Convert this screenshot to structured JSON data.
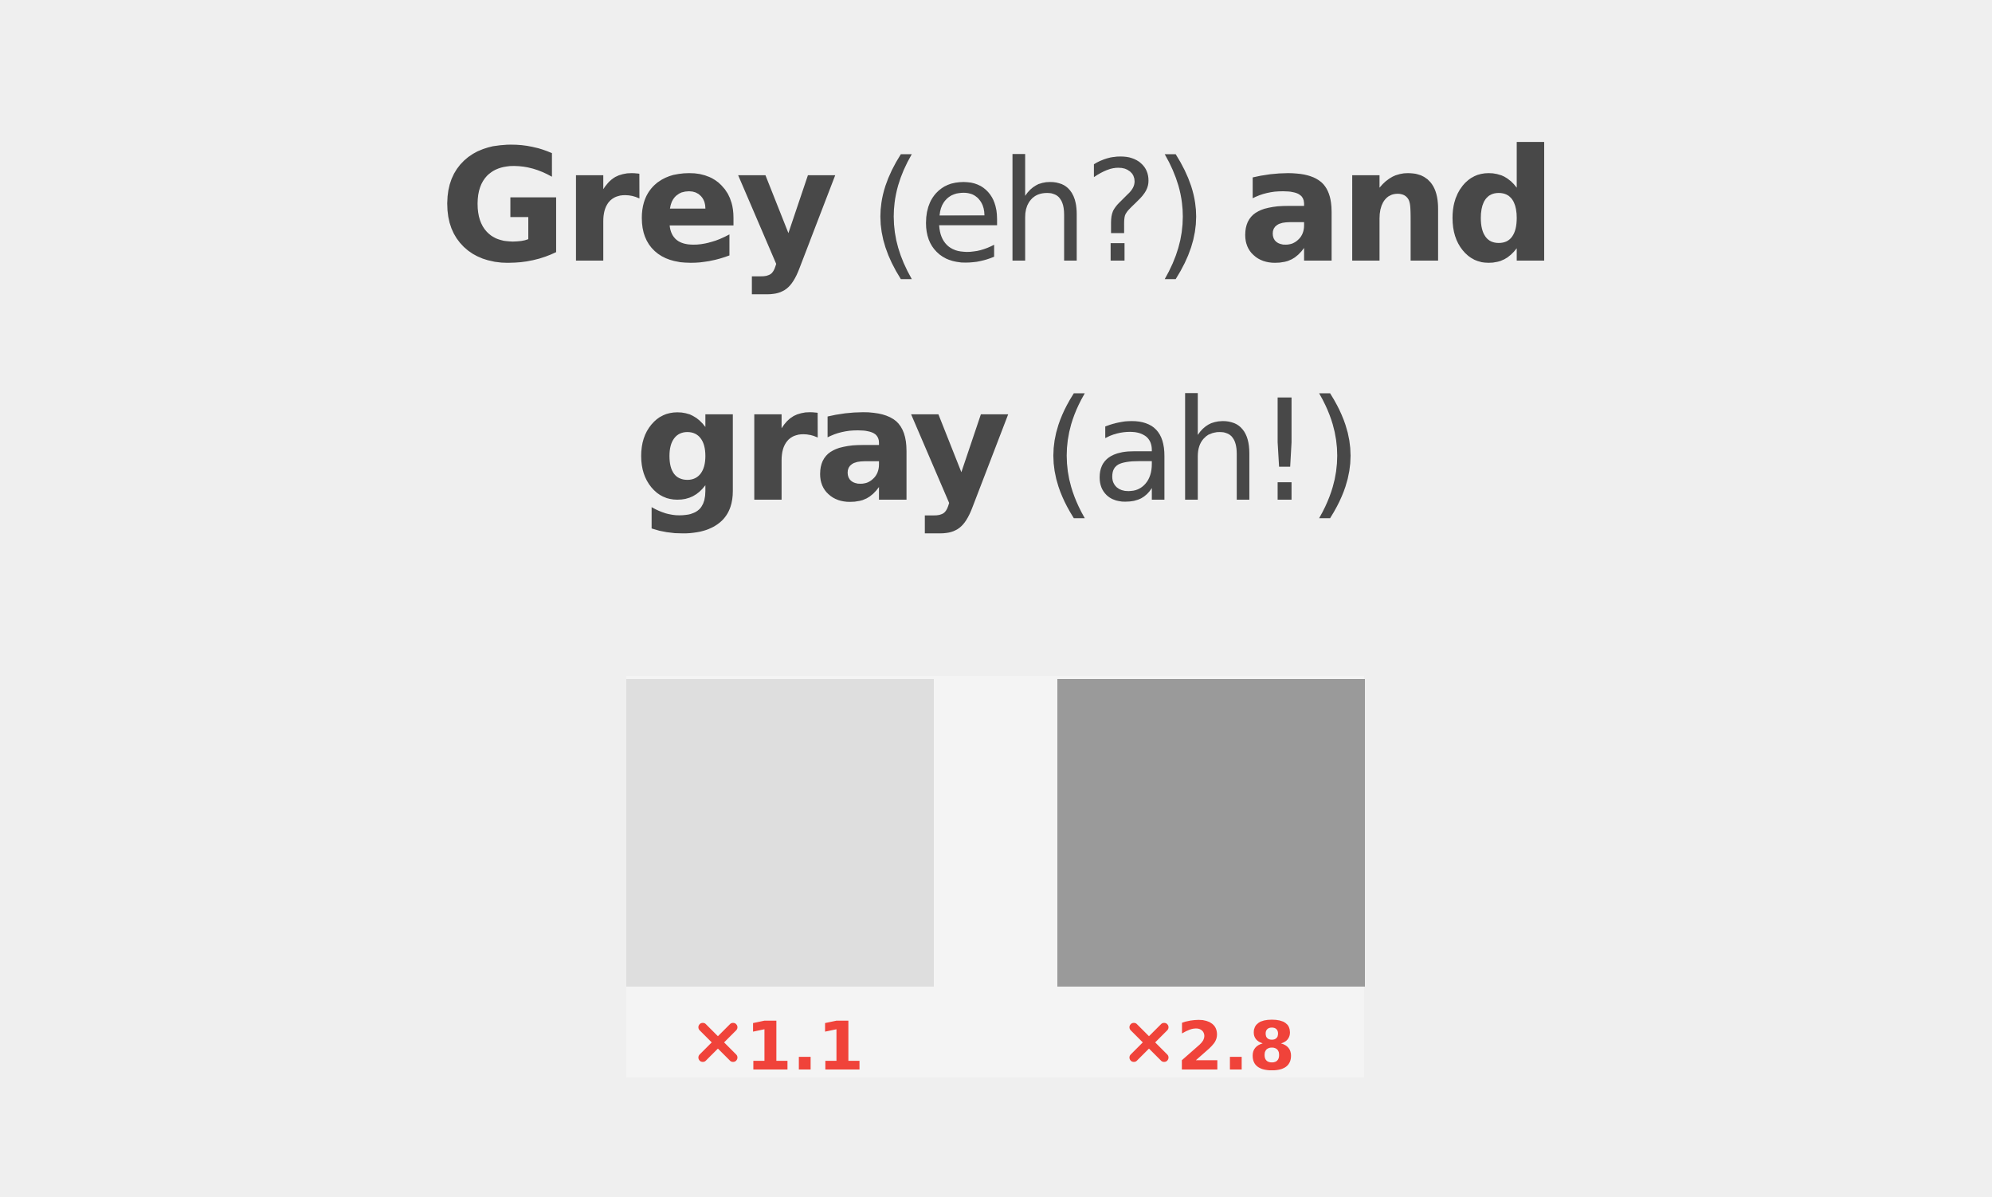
{
  "title": {
    "line1": {
      "word1": "Grey",
      "aside1": "(eh?)",
      "word2": "and"
    },
    "line2": {
      "word": "gray",
      "aside": "(ah!)"
    }
  },
  "swatches": [
    {
      "color": "#dedede",
      "ratio": "1.1"
    },
    {
      "color": "#9a9a9a",
      "ratio": "2.8"
    }
  ],
  "colors": {
    "background": "#efefef",
    "text": "#484848",
    "panel": "#f4f4f4",
    "fail": "#f0433a"
  },
  "icons": {
    "ratio_icon": "cross-icon"
  }
}
